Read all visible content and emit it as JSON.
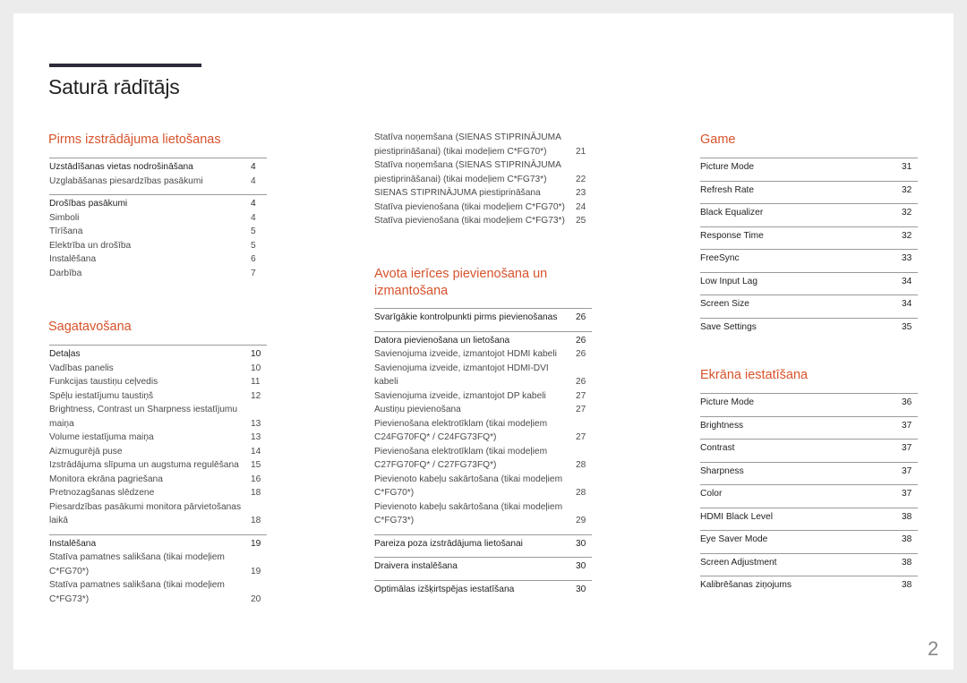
{
  "title": "Saturā rādītājs",
  "page_number": "2",
  "accent_color": "#d6532c",
  "sections": [
    {
      "heading": "Pirms izstrādājuma lietošanas",
      "groups": [
        [
          [
            "Uzstādīšanas vietas nodrošināšana",
            "4"
          ],
          [
            "Uzglabāšanas piesardzības pasākumi",
            "4"
          ]
        ],
        [
          [
            "Drošības pasākumi",
            "4"
          ],
          [
            "Simboli",
            "4"
          ],
          [
            "Tīrīšana",
            "5"
          ],
          [
            "Elektrība un drošība",
            "5"
          ],
          [
            "Instalēšana",
            "6"
          ],
          [
            "Darbība",
            "7"
          ]
        ]
      ]
    },
    {
      "heading": "Sagatavošana",
      "groups": [
        [
          [
            "Detaļas",
            "10"
          ],
          [
            "Vadības panelis",
            "10"
          ],
          [
            "Funkcijas taustiņu ceļvedis",
            "11"
          ],
          [
            "Spēļu iestatījumu taustiņš",
            "12"
          ],
          [
            "Brightness, Contrast un Sharpness iestatījumu maiņa",
            "13"
          ],
          [
            "Volume iestatījuma maiņa",
            "13"
          ],
          [
            "Aizmugurējā puse",
            "14"
          ],
          [
            "Izstrādājuma slīpuma un augstuma regulēšana",
            "15"
          ],
          [
            "Monitora ekrāna pagriešana",
            "16"
          ],
          [
            "Pretnozagšanas slēdzene",
            "18"
          ],
          [
            "Piesardzības pasākumi monitora pārvietošanas laikā",
            "18"
          ]
        ],
        [
          [
            "Instalēšana",
            "19"
          ],
          [
            "Statīva pamatnes salikšana (tikai modeļiem C*FG70*)",
            "19"
          ],
          [
            "Statīva pamatnes salikšana (tikai modeļiem C*FG73*)",
            "20"
          ]
        ]
      ]
    },
    {
      "heading": "",
      "groups": [
        [
          [
            "Statīva noņemšana (SIENAS STIPRINĀJUMA piestiprināšanai) (tikai modeļiem C*FG70*)",
            "21"
          ],
          [
            "Statīva noņemšana (SIENAS STIPRINĀJUMA piestiprināšanai) (tikai modeļiem C*FG73*)",
            "22"
          ],
          [
            "SIENAS STIPRINĀJUMA piestiprināšana",
            "23"
          ],
          [
            "Statīva pievienošana (tikai modeļiem C*FG70*)",
            "24"
          ],
          [
            "Statīva pievienošana (tikai modeļiem C*FG73*)",
            "25"
          ]
        ]
      ]
    },
    {
      "heading": "Avota ierīces pievienošana un izmantošana",
      "groups": [
        [
          [
            "Svarīgākie kontrolpunkti pirms pievienošanas",
            "26"
          ]
        ],
        [
          [
            "Datora pievienošana un lietošana",
            "26"
          ],
          [
            "Savienojuma izveide, izmantojot HDMI kabeli",
            "26"
          ],
          [
            "Savienojuma izveide, izmantojot HDMI-DVI kabeli",
            "26"
          ],
          [
            "Savienojuma izveide, izmantojot DP kabeli",
            "27"
          ],
          [
            "Austiņu pievienošana",
            "27"
          ],
          [
            "Pievienošana elektrotīklam (tikai modeļiem C24FG70FQ* / C24FG73FQ*)",
            "27"
          ],
          [
            "Pievienošana elektrotīklam (tikai modeļiem C27FG70FQ* / C27FG73FQ*)",
            "28"
          ],
          [
            "Pievienoto kabeļu sakārtošana (tikai modeļiem C*FG70*)",
            "28"
          ],
          [
            "Pievienoto kabeļu sakārtošana (tikai modeļiem C*FG73*)",
            "29"
          ]
        ],
        [
          [
            "Pareiza poza izstrādājuma lietošanai",
            "30"
          ]
        ],
        [
          [
            "Draivera instalēšana",
            "30"
          ]
        ],
        [
          [
            "Optimālas izšķirtspējas iestatīšana",
            "30"
          ]
        ]
      ]
    },
    {
      "heading": "Game",
      "groups": [
        [
          [
            "Picture Mode",
            "31"
          ]
        ],
        [
          [
            "Refresh Rate",
            "32"
          ]
        ],
        [
          [
            "Black Equalizer",
            "32"
          ]
        ],
        [
          [
            "Response Time",
            "32"
          ]
        ],
        [
          [
            "FreeSync",
            "33"
          ]
        ],
        [
          [
            "Low Input Lag",
            "34"
          ]
        ],
        [
          [
            "Screen Size",
            "34"
          ]
        ],
        [
          [
            "Save Settings",
            "35"
          ]
        ]
      ]
    },
    {
      "heading": "Ekrāna iestatīšana",
      "groups": [
        [
          [
            "Picture Mode",
            "36"
          ]
        ],
        [
          [
            "Brightness",
            "37"
          ]
        ],
        [
          [
            "Contrast",
            "37"
          ]
        ],
        [
          [
            "Sharpness",
            "37"
          ]
        ],
        [
          [
            "Color",
            "37"
          ]
        ],
        [
          [
            "HDMI Black Level",
            "38"
          ]
        ],
        [
          [
            "Eye Saver Mode",
            "38"
          ]
        ],
        [
          [
            "Screen Adjustment",
            "38"
          ]
        ],
        [
          [
            "Kalibrēšanas ziņojums",
            "38"
          ]
        ]
      ]
    }
  ]
}
